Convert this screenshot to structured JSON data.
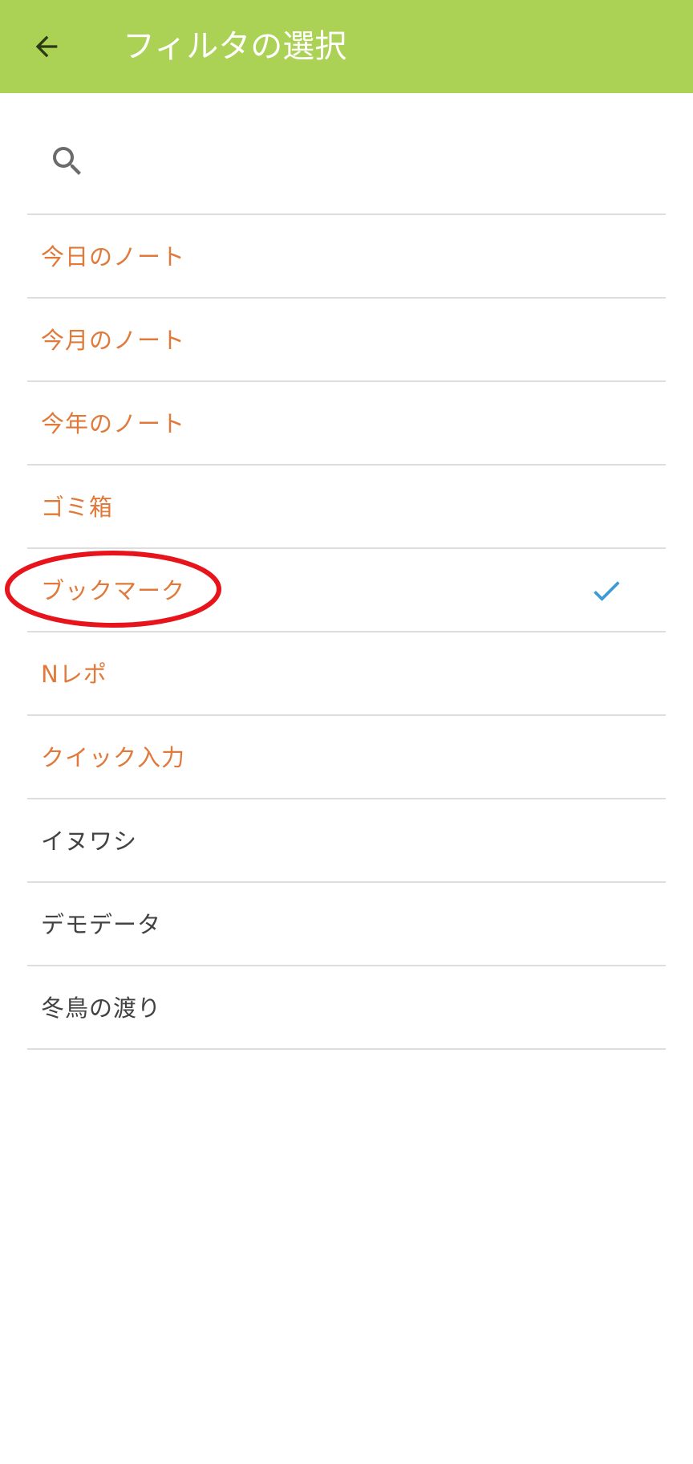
{
  "colors": {
    "app_bar": "#abd254",
    "builtin_text": "#e0793a",
    "user_text": "#424242",
    "check": "#3a9bd6",
    "highlight": "#e8141b"
  },
  "header": {
    "back_icon": "arrow-back-icon",
    "title": "フィルタの選択"
  },
  "search": {
    "icon": "search-icon",
    "value": "",
    "placeholder": ""
  },
  "filters": [
    {
      "label": "今日のノート",
      "kind": "builtin",
      "selected": false
    },
    {
      "label": "今月のノート",
      "kind": "builtin",
      "selected": false
    },
    {
      "label": "今年のノート",
      "kind": "builtin",
      "selected": false
    },
    {
      "label": "ゴミ箱",
      "kind": "builtin",
      "selected": false
    },
    {
      "label": "ブックマーク",
      "kind": "builtin",
      "selected": true,
      "annotated": true
    },
    {
      "label": "Nレポ",
      "kind": "builtin",
      "selected": false
    },
    {
      "label": "クイック入力",
      "kind": "builtin",
      "selected": false
    },
    {
      "label": "イヌワシ",
      "kind": "user",
      "selected": false
    },
    {
      "label": "デモデータ",
      "kind": "user",
      "selected": false
    },
    {
      "label": "冬鳥の渡り",
      "kind": "user",
      "selected": false
    }
  ]
}
